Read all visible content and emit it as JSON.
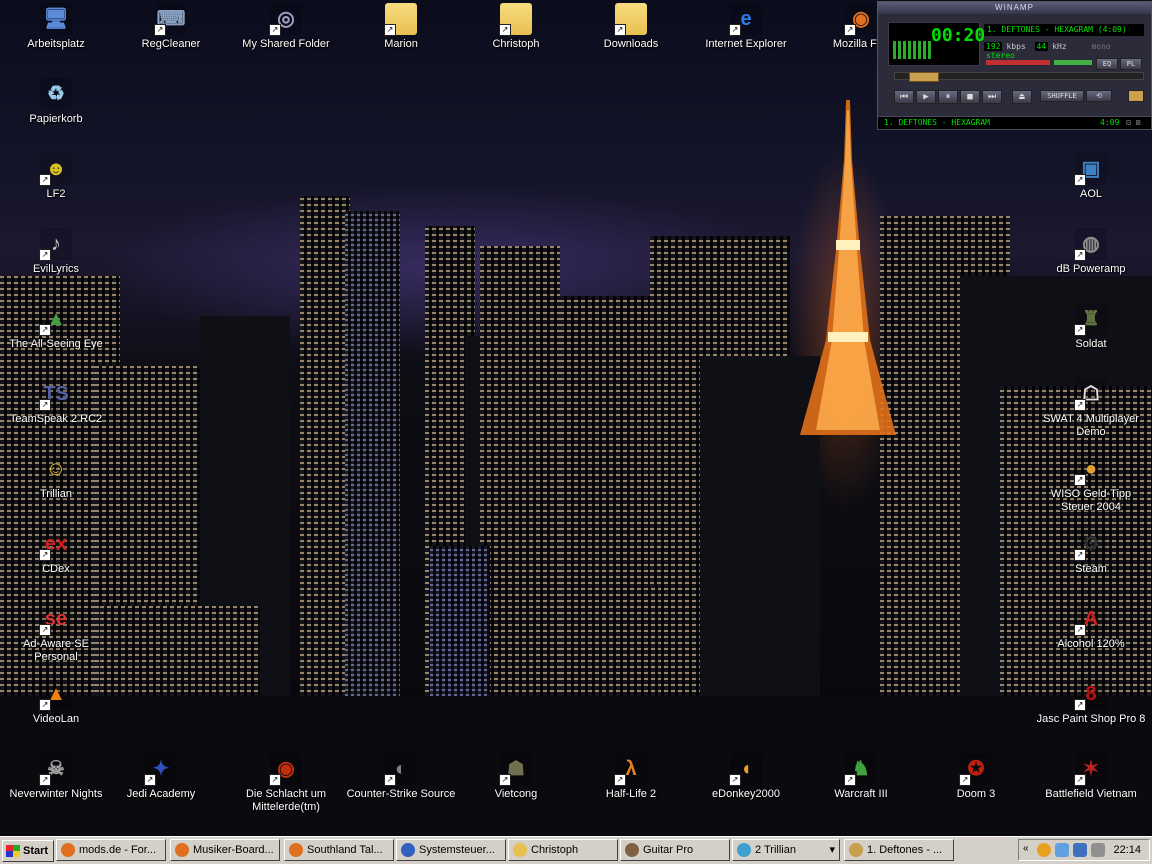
{
  "desktop": {
    "icons": [
      {
        "label": "Arbeitsplatz",
        "glyph": "🖥",
        "color": "#5a8ad8",
        "shortcut": false
      },
      {
        "label": "RegCleaner",
        "glyph": "⌨",
        "color": "#8aa0c0",
        "shortcut": true
      },
      {
        "label": "My Shared Folder",
        "glyph": "◎",
        "color": "#a0a0c8",
        "shortcut": true
      },
      {
        "label": "Marion",
        "glyph": "",
        "color": "#e8c050",
        "shortcut": true
      },
      {
        "label": "Christoph",
        "glyph": "",
        "color": "#e8c050",
        "shortcut": true
      },
      {
        "label": "Downloads",
        "glyph": "",
        "color": "#e8c050",
        "shortcut": true
      },
      {
        "label": "Internet Explorer",
        "glyph": "e",
        "color": "#2d7ae0",
        "shortcut": true
      },
      {
        "label": "Mozilla Fire",
        "glyph": "◉",
        "color": "#e07020",
        "shortcut": true
      },
      {
        "label": "Papierkorb",
        "glyph": "♻",
        "color": "#9ac8e8",
        "shortcut": false
      },
      {
        "label": "LF2",
        "glyph": "☻",
        "color": "#d8c020",
        "shortcut": true
      },
      {
        "label": "EvilLyrics",
        "glyph": "♪",
        "color": "#c8c8c8",
        "shortcut": true
      },
      {
        "label": "The All-Seeing Eye",
        "glyph": "▲",
        "color": "#40a040",
        "shortcut": true
      },
      {
        "label": "TeamSpeak 2 RC2",
        "glyph": "TS",
        "color": "#5060a0",
        "shortcut": true
      },
      {
        "label": "Trillian",
        "glyph": "☺",
        "color": "#e8c030",
        "shortcut": false
      },
      {
        "label": "CDex",
        "glyph": "ex",
        "color": "#d02020",
        "shortcut": true
      },
      {
        "label": "Ad-Aware SE Personal",
        "glyph": "se",
        "color": "#e03030",
        "shortcut": true
      },
      {
        "label": "VideoLan",
        "glyph": "▲",
        "color": "#f08010",
        "shortcut": true
      },
      {
        "label": "Neverwinter Nights",
        "glyph": "☠",
        "color": "#a0a0a0",
        "shortcut": true
      },
      {
        "label": "Jedi Academy",
        "glyph": "✦",
        "color": "#3050c0",
        "shortcut": true
      },
      {
        "label": "Die Schlacht um Mittelerde(tm)",
        "glyph": "◉",
        "color": "#c03010",
        "shortcut": true
      },
      {
        "label": "Counter-Strike Source",
        "glyph": "◐",
        "color": "#808080",
        "shortcut": true
      },
      {
        "label": "Vietcong",
        "glyph": "☗",
        "color": "#707050",
        "shortcut": true
      },
      {
        "label": "Half-Life 2",
        "glyph": "λ",
        "color": "#e08020",
        "shortcut": true
      },
      {
        "label": "eDonkey2000",
        "glyph": "◖",
        "color": "#f0a020",
        "shortcut": true
      },
      {
        "label": "Warcraft III",
        "glyph": "♞",
        "color": "#40a040",
        "shortcut": true
      },
      {
        "label": "Doom 3",
        "glyph": "✪",
        "color": "#c02010",
        "shortcut": true
      },
      {
        "label": "Battlefield Vietnam",
        "glyph": "✶",
        "color": "#c02020",
        "shortcut": true
      },
      {
        "label": "AOL",
        "glyph": "▣",
        "color": "#4080c0",
        "shortcut": true
      },
      {
        "label": "dB Poweramp",
        "glyph": "◍",
        "color": "#909090",
        "shortcut": true
      },
      {
        "label": "Soldat",
        "glyph": "♜",
        "color": "#607040",
        "shortcut": true
      },
      {
        "label": "SWAT 4 Multiplayer Demo",
        "glyph": "☖",
        "color": "#e0e0e0",
        "shortcut": true
      },
      {
        "label": "WISO Geld-Tipp Steuer 2004",
        "glyph": "●",
        "color": "#e0a030",
        "shortcut": true
      },
      {
        "label": "Steam",
        "glyph": "⚙",
        "color": "#303030",
        "shortcut": true
      },
      {
        "label": "Alcohol 120%",
        "glyph": "A",
        "color": "#d02020",
        "shortcut": true
      },
      {
        "label": "Jasc Paint Shop Pro 8",
        "glyph": "8",
        "color": "#c01010",
        "shortcut": true
      }
    ]
  },
  "winamp": {
    "title": "WINAMP",
    "time": "00:20",
    "track": "1. DEFTONES - HEXAGRAM (4:09)",
    "kbps": "192",
    "kbps_unit": "kbps",
    "khz": "44",
    "khz_unit": "kHz",
    "mono": "mono",
    "stereo": "stereo",
    "eq": "EQ",
    "pl": "PL",
    "shuffle": "SHUFFLE",
    "playlist_item": "1. DEFTONES - HEXAGRAM",
    "playlist_time": "4:09"
  },
  "taskbar": {
    "start": "Start",
    "tasks": [
      {
        "label": "mods.de - For...",
        "color": "#e07020"
      },
      {
        "label": "Musiker-Board...",
        "color": "#e07020"
      },
      {
        "label": "Southland Tal...",
        "color": "#e07020"
      },
      {
        "label": "Systemsteuer...",
        "color": "#3060c0"
      },
      {
        "label": "Christoph",
        "color": "#e8c050"
      },
      {
        "label": "Guitar Pro",
        "color": "#806040"
      },
      {
        "label": "2 Trillian",
        "color": "#40a0d0"
      },
      {
        "label": "1. Deftones - ...",
        "color": "#c8a050"
      }
    ],
    "clock": "22:14"
  }
}
